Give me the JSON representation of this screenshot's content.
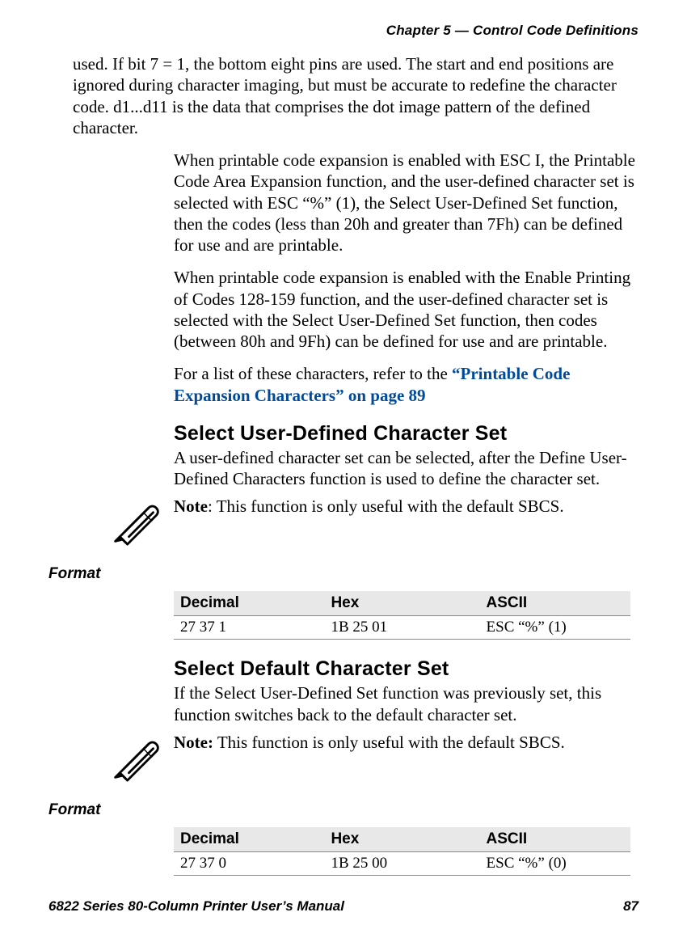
{
  "header": {
    "chapter": "Chapter 5 — Control Code Definitions"
  },
  "paragraphs": {
    "intro_cont": "used. If bit 7 = 1, the bottom eight pins are used. The start and end positions are ignored during character imaging, but must be accurate to redefine the character code. d1...d11 is the data that comprises the dot image pattern of the defined character.",
    "p2": "When printable code expansion is enabled with ESC I, the Printable Code Area Expansion function, and the user-defined character set is selected with ESC “%” (1), the Select User-Defined Set function, then the codes (less than 20h and greater than 7Fh) can be defined for use and are printable.",
    "p3": "When printable code expansion is enabled with the Enable Printing of Codes 128-159 function, and the user-defined character set is selected with the Select User-Defined Set function, then codes (between 80h and 9Fh) can be defined for use and are printable.",
    "p4_lead": "For a list of these characters, refer to the ",
    "p4_link": "“Printable Code Expansion Characters” on page 89"
  },
  "section1": {
    "heading": "Select User-Defined Character Set",
    "body": "A user-defined character set can be selected, after the Define User-Defined Characters function is used to define the character set.",
    "note_label": "Note",
    "note_sep": ": ",
    "note_body": "This function is only useful with the default SBCS."
  },
  "format_label": "Format",
  "table1": {
    "headers": {
      "c1": "Decimal",
      "c2": "Hex",
      "c3": "ASCII"
    },
    "row": {
      "c1": "27 37 1",
      "c2": "1B 25 01",
      "c3": "ESC “%” (1)"
    }
  },
  "section2": {
    "heading": "Select Default Character Set",
    "body": "If the Select User-Defined Set function was previously set, this function switches back to the default character set.",
    "note_label": "Note:",
    "note_sep": " ",
    "note_body": "This function is only useful with the default SBCS."
  },
  "table2": {
    "headers": {
      "c1": "Decimal",
      "c2": "Hex",
      "c3": "ASCII"
    },
    "row": {
      "c1": "27 37 0",
      "c2": "1B 25 00",
      "c3": "ESC “%” (0)"
    }
  },
  "footer": {
    "left": "6822 Series 80-Column Printer User’s Manual",
    "right": "87"
  }
}
